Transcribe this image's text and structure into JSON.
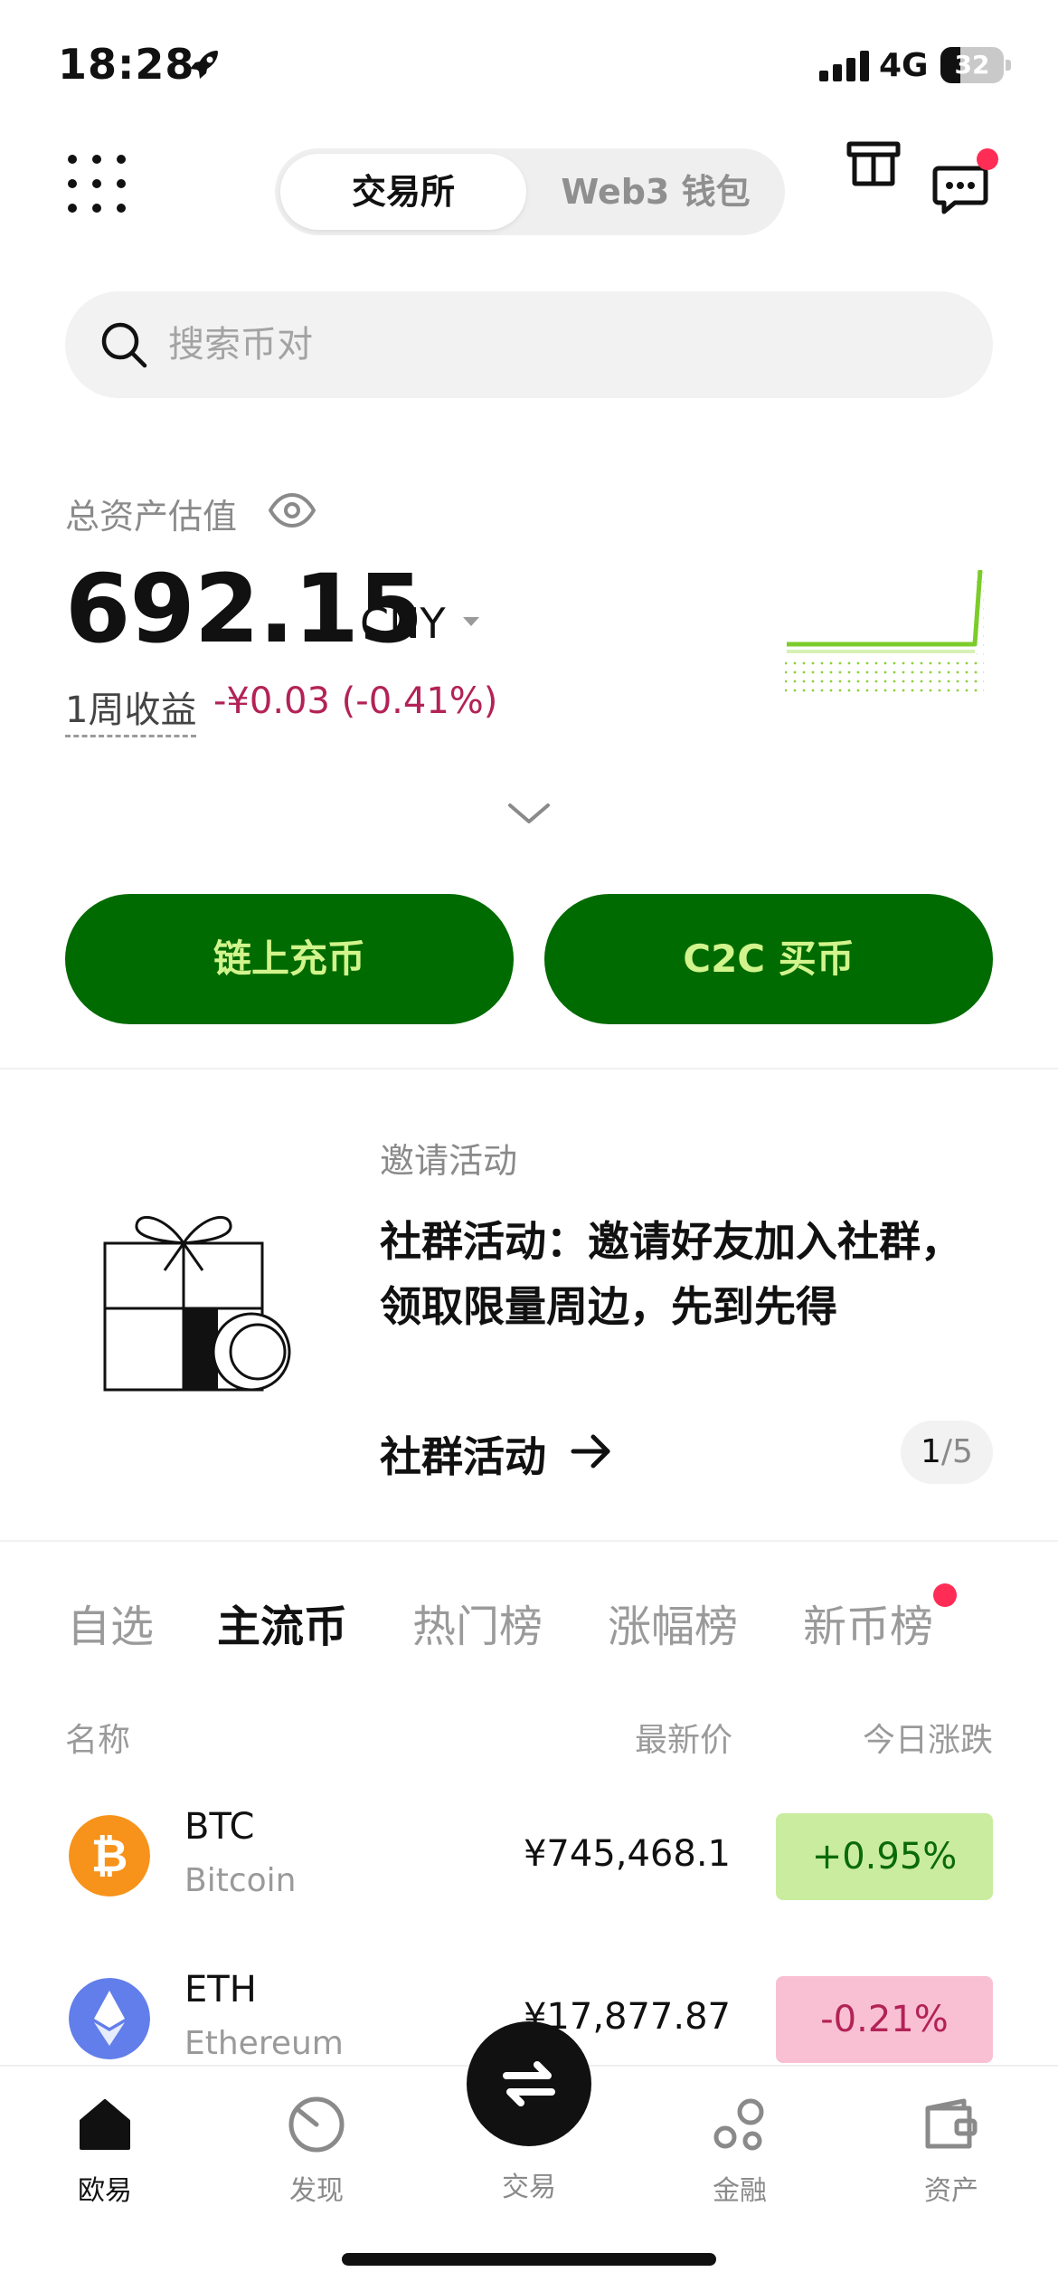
{
  "status_bar": {
    "time": "18:28",
    "network": "4G",
    "battery": "32",
    "battery_level": 0.32
  },
  "header": {
    "segments": [
      {
        "label": "交易所",
        "active": true
      },
      {
        "label": "Web3 钱包",
        "active": false
      }
    ],
    "icons": [
      "grid-menu-icon",
      "gift-icon",
      "chat-icon"
    ]
  },
  "search": {
    "placeholder": "搜索币对"
  },
  "assets": {
    "label": "总资产估值",
    "value": "692.15",
    "currency": "CNY",
    "week_label": "1周收益",
    "week_value": "-¥0.03 (-0.41%)"
  },
  "actions": {
    "deposit": "链上充币",
    "buy": "C2C 买币"
  },
  "promo": {
    "kicker": "邀请活动",
    "title": "社群活动：邀请好友加入社群，领取限量周边，先到先得",
    "link": "社群活动",
    "pager_current": "1",
    "pager_total": "/5"
  },
  "market": {
    "tabs": [
      "自选",
      "主流币",
      "热门榜",
      "涨幅榜",
      "新币榜"
    ],
    "active_tab": "主流币",
    "columns": {
      "name": "名称",
      "price": "最新价",
      "change": "今日涨跌"
    },
    "rows": [
      {
        "symbol": "BTC",
        "name": "Bitcoin",
        "price": "¥745,468.1",
        "change": "+0.95%",
        "direction": "up",
        "logo_color": "#f7931a"
      },
      {
        "symbol": "ETH",
        "name": "Ethereum",
        "price": "¥17,877.87",
        "change": "-0.21%",
        "direction": "down",
        "logo_color": "#627eea"
      }
    ]
  },
  "bottom_nav": {
    "items": [
      {
        "label": "欧易",
        "icon": "home-icon",
        "active": true
      },
      {
        "label": "发现",
        "icon": "discover-icon",
        "active": false
      },
      {
        "label": "交易",
        "icon": "swap-icon",
        "active": false
      },
      {
        "label": "金融",
        "icon": "finance-icon",
        "active": false
      },
      {
        "label": "资产",
        "icon": "wallet-icon",
        "active": false
      }
    ]
  },
  "colors": {
    "brand_green": "#006b00",
    "accent_lime": "#d2f48c",
    "negative": "#b32256",
    "positive": "#0a6a0a",
    "badge_dot": "#ff2d55"
  }
}
